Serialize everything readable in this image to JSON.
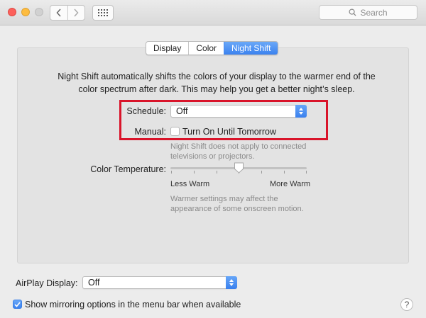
{
  "toolbar": {
    "back_icon": "chevron-left-icon",
    "forward_icon": "chevron-right-icon",
    "show_all_icon": "grid-icon",
    "search_placeholder": "Search"
  },
  "tabs": [
    {
      "label": "Display",
      "active": false
    },
    {
      "label": "Color",
      "active": false
    },
    {
      "label": "Night Shift",
      "active": true
    }
  ],
  "night_shift": {
    "description": "Night Shift automatically shifts the colors of your display to the warmer end of the color spectrum after dark. This may help you get a better night’s sleep.",
    "schedule_label": "Schedule:",
    "schedule_value": "Off",
    "manual_label": "Manual:",
    "manual_checkbox_label": "Turn On Until Tomorrow",
    "manual_checked": false,
    "note_line1": "Night Shift does not apply to connected",
    "note_line2": "televisions or projectors.",
    "color_temp_label": "Color Temperature:",
    "slider_min_label": "Less Warm",
    "slider_max_label": "More Warm",
    "slider_value": 0.5,
    "warning_line1": "Warmer settings may affect the",
    "warning_line2": "appearance of some onscreen motion."
  },
  "airplay": {
    "label": "AirPlay Display:",
    "value": "Off"
  },
  "mirroring": {
    "label": "Show mirroring options in the menu bar when available",
    "checked": true
  },
  "help_label": "?",
  "colors": {
    "accent": "#3b82ef",
    "highlight_box": "#d9142a"
  }
}
